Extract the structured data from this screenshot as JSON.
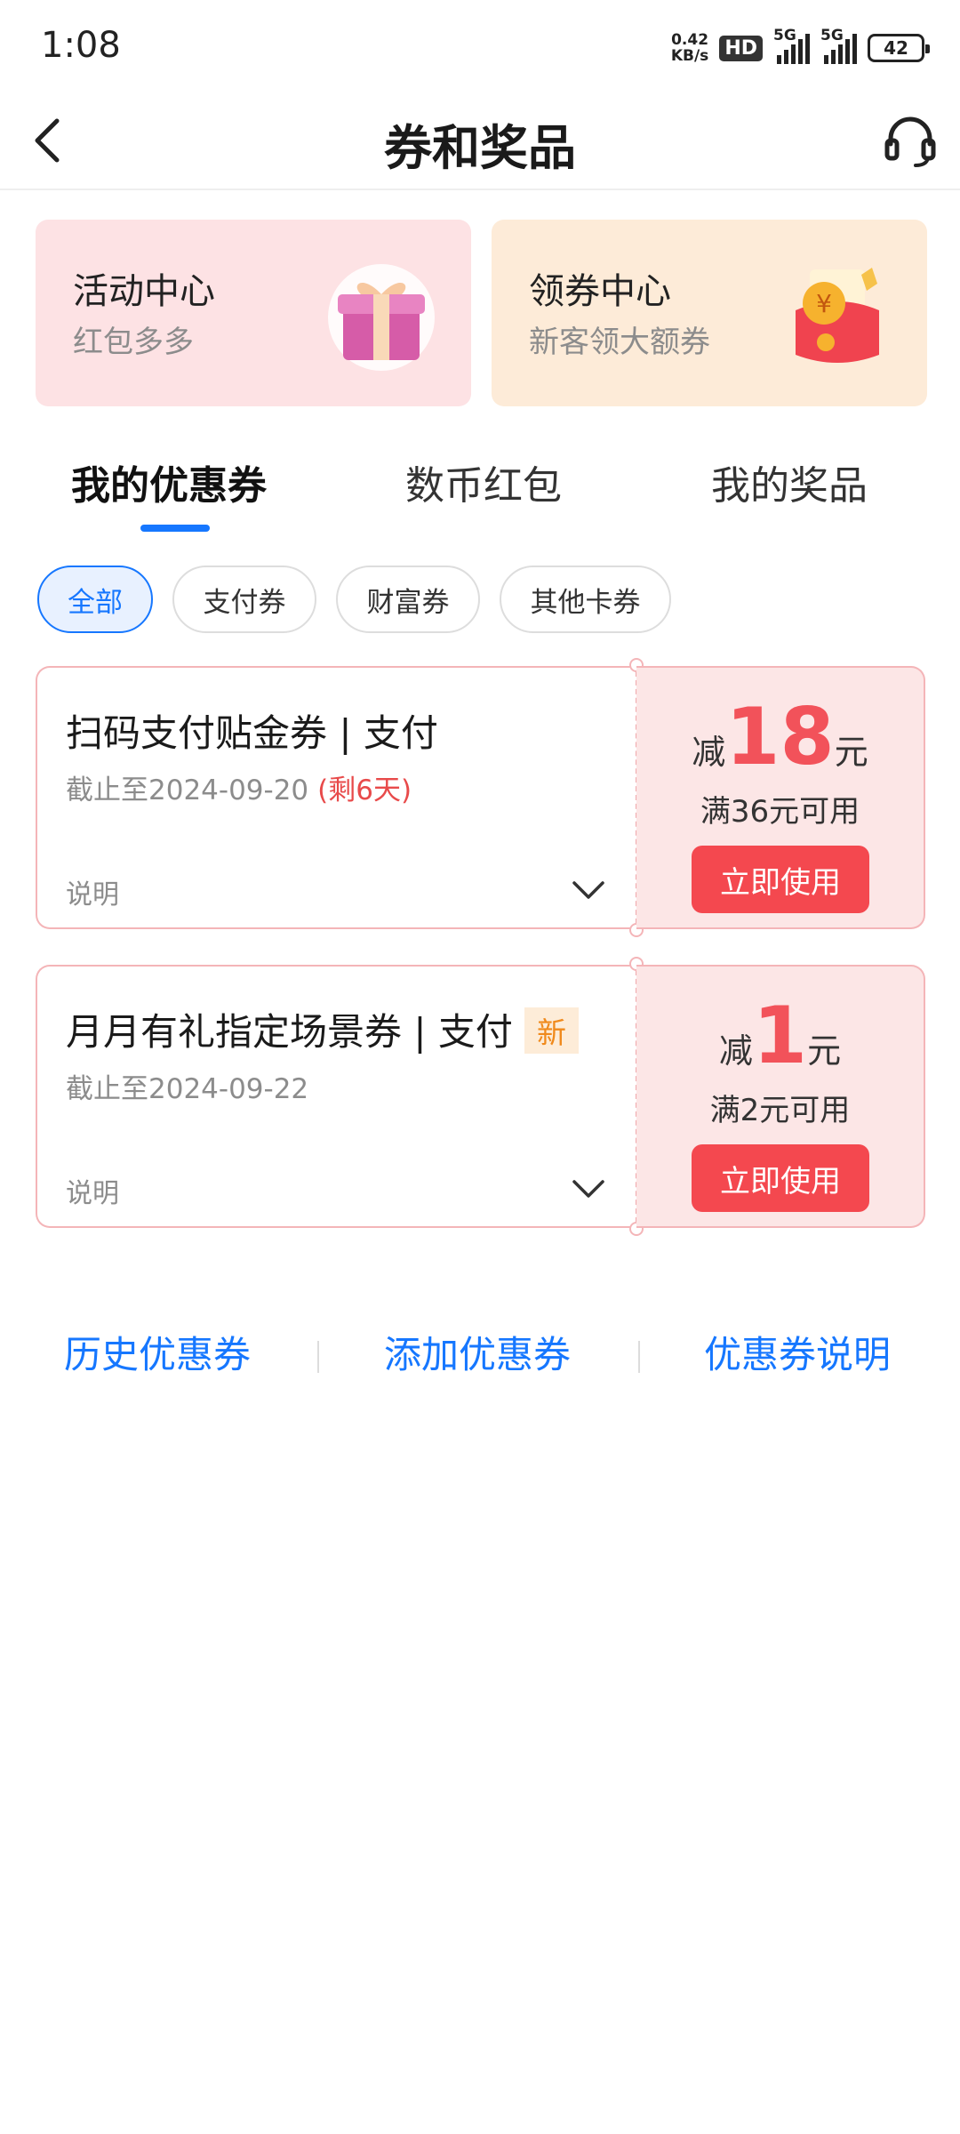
{
  "status_bar": {
    "time": "1:08",
    "net_speed_value": "0.42",
    "net_speed_unit": "KB/s",
    "hd": "HD",
    "signal1": "5G",
    "signal2": "5G",
    "battery": "42"
  },
  "nav": {
    "title": "券和奖品",
    "back_icon": "chevron-left-icon",
    "service_icon": "headset-icon"
  },
  "top_cards": [
    {
      "title": "活动中心",
      "subtitle": "红包多多",
      "icon": "gift-box-icon"
    },
    {
      "title": "领券中心",
      "subtitle": "新客领大额券",
      "icon": "red-envelope-icon"
    }
  ],
  "tabs": [
    {
      "label": "我的优惠券",
      "active": true
    },
    {
      "label": "数币红包",
      "active": false
    },
    {
      "label": "我的奖品",
      "active": false
    }
  ],
  "filters": [
    {
      "label": "全部",
      "active": true
    },
    {
      "label": "支付券",
      "active": false
    },
    {
      "label": "财富券",
      "active": false
    },
    {
      "label": "其他卡券",
      "active": false
    }
  ],
  "coupons": [
    {
      "title": "扫码支付贴金券 | 支付",
      "badge": "",
      "date": "截止至2024-09-20",
      "remain": "(剩6天)",
      "note": "说明",
      "prefix": "减",
      "amount": "18",
      "unit": "元",
      "threshold": "满36元可用",
      "button": "立即使用"
    },
    {
      "title": "月月有礼指定场景券 | 支付",
      "badge": "新",
      "date": "截止至2024-09-22",
      "remain": "",
      "note": "说明",
      "prefix": "减",
      "amount": "1",
      "unit": "元",
      "threshold": "满2元可用",
      "button": "立即使用"
    }
  ],
  "bottom_links": [
    "历史优惠券",
    "添加优惠券",
    "优惠券说明"
  ],
  "colors": {
    "accent": "#1677ff",
    "coupon_red": "#f2525a",
    "button_red": "#f4484f",
    "badge_orange": "#f08a1c"
  }
}
